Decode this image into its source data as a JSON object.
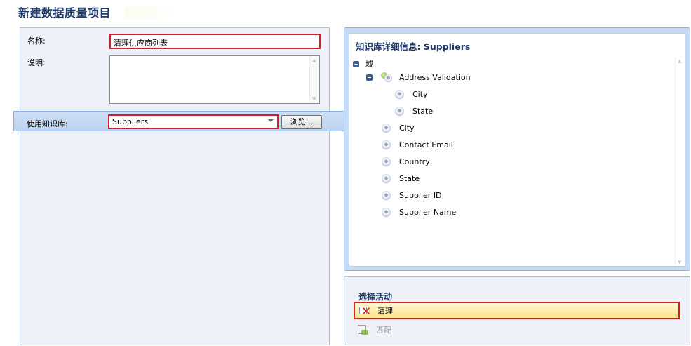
{
  "page": {
    "title": "新建数据质量项目"
  },
  "form": {
    "name_label": "名称:",
    "name_value": "清理供应商列表",
    "description_label": "说明:",
    "description_value": "",
    "kb_label": "使用知识库:",
    "kb_value": "Suppliers",
    "browse_label": "浏览..."
  },
  "kb_details": {
    "title": "知识库详细信息: Suppliers",
    "tree": {
      "root": "域",
      "composite": {
        "label": "Address Validation",
        "children": [
          "City",
          "State"
        ]
      },
      "domains": [
        "City",
        "Contact Email",
        "Country",
        "State",
        "Supplier ID",
        "Supplier Name"
      ]
    }
  },
  "activities": {
    "title": "选择活动",
    "items": [
      {
        "label": "清理",
        "selected": true,
        "enabled": true
      },
      {
        "label": "匹配",
        "selected": false,
        "enabled": false
      }
    ]
  },
  "colors": {
    "heading": "#1f3a6b",
    "highlight_border": "#d21f2b",
    "selected_fill": "#fde48c",
    "panel_blue": "#c6dbf5"
  }
}
